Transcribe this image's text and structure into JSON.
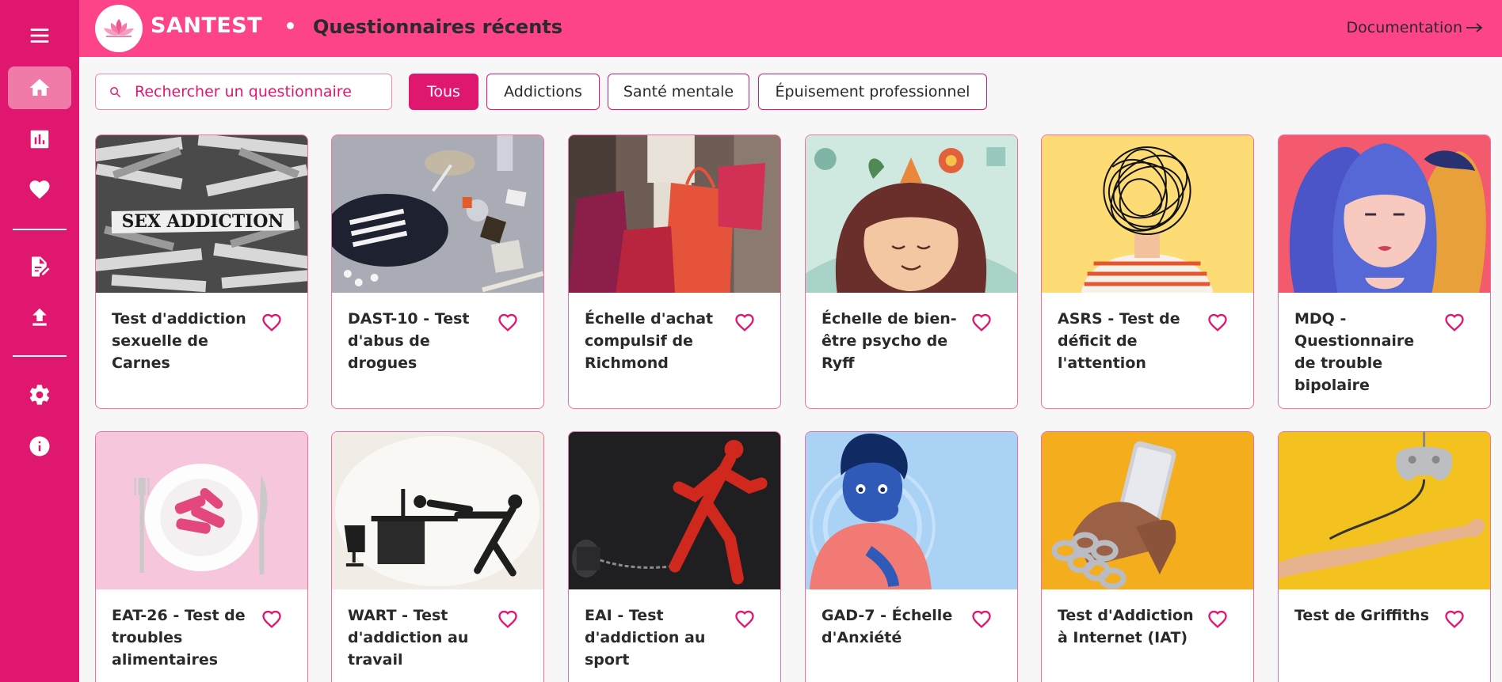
{
  "sidebar": {
    "items": [
      {
        "name": "menu-icon"
      },
      {
        "name": "home-icon",
        "active": true
      },
      {
        "name": "chart-icon"
      },
      {
        "name": "heart-icon"
      },
      {
        "name": "edit-document-icon"
      },
      {
        "name": "upload-icon"
      },
      {
        "name": "settings-icon"
      },
      {
        "name": "info-icon"
      }
    ],
    "color": "#e0176f"
  },
  "header": {
    "brand": "SANTEST",
    "title": "Questionnaires récents",
    "doc_link": "Documentation",
    "color": "#fe4489"
  },
  "search": {
    "placeholder": "Rechercher un questionnaire"
  },
  "filters": [
    {
      "label": "Tous",
      "active": true
    },
    {
      "label": "Addictions",
      "active": false
    },
    {
      "label": "Santé mentale",
      "active": false
    },
    {
      "label": "Épuisement professionnel",
      "active": false
    }
  ],
  "cards": [
    {
      "title": "Test d'addiction sexuelle de Carnes",
      "image": "sex-addiction-newspaper-image"
    },
    {
      "title": "DAST-10 - Test d'abus de drogues",
      "image": "drugs-mirror-image"
    },
    {
      "title": "Échelle d'achat compulsif de Richmond",
      "image": "shopping-bags-image"
    },
    {
      "title": "Échelle de bien-être psycho de Ryff",
      "image": "wellbeing-girl-flowers-image"
    },
    {
      "title": "ASRS - Test de déficit de l'attention",
      "image": "scribble-head-image"
    },
    {
      "title": "MDQ - Questionnaire de trouble bipolaire",
      "image": "three-faces-image"
    },
    {
      "title": "EAT-26 - Test de troubles alimentaires",
      "image": "tape-plate-image"
    },
    {
      "title": "WART - Test d'addiction au travail",
      "image": "desk-pulling-figure-image"
    },
    {
      "title": "EAI - Test d'addiction au sport",
      "image": "red-runner-chained-image"
    },
    {
      "title": "GAD-7 - Échelle d'Anxiété",
      "image": "anxious-person-image"
    },
    {
      "title": "Test d'Addiction à Internet (IAT)",
      "image": "chained-phone-hands-image"
    },
    {
      "title": "Test de Griffiths",
      "image": "controller-arm-image"
    }
  ],
  "accent": "#e0176f"
}
